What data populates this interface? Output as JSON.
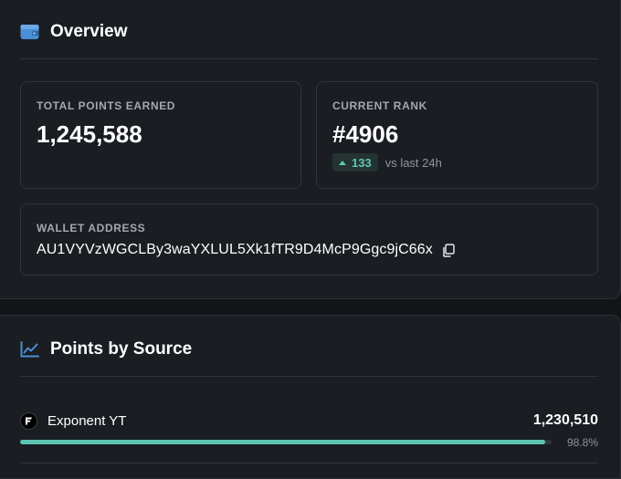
{
  "overview": {
    "title": "Overview",
    "icon": "wallet-icon",
    "total_points": {
      "label": "TOTAL POINTS EARNED",
      "value": "1,245,588"
    },
    "current_rank": {
      "label": "CURRENT RANK",
      "value": "#4906",
      "change": "133",
      "change_suffix": "vs last 24h",
      "change_direction": "up"
    },
    "wallet": {
      "label": "WALLET ADDRESS",
      "address": "AU1VYVzWGCLBy3waYXLUL5Xk1fTR9D4McP9Ggc9jC66x",
      "copy_icon": "copy-icon"
    }
  },
  "points_by_source": {
    "title": "Points by Source",
    "icon": "line-chart-icon",
    "sources": [
      {
        "name": "Exponent YT",
        "value": "1,230,510",
        "percent_label": "98.8%",
        "percent": 98.8
      }
    ]
  },
  "colors": {
    "accent": "#5cc4b0",
    "icon_blue": "#4a8fd6",
    "background": "#1a1d22"
  }
}
